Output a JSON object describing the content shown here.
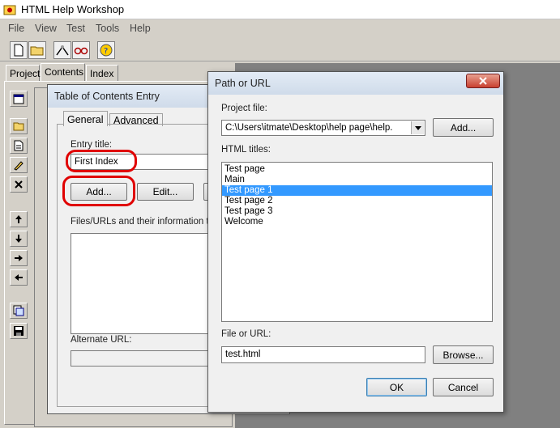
{
  "app": {
    "title": "HTML Help Workshop"
  },
  "menu": [
    "File",
    "View",
    "Test",
    "Tools",
    "Help"
  ],
  "toolbar_icons": [
    "new-file-icon",
    "open-folder-icon",
    "compile-icon",
    "view-icon",
    "help-icon"
  ],
  "left_tabs": [
    "Project",
    "Contents",
    "Index"
  ],
  "toc_dialog": {
    "title": "Table of Contents Entry",
    "tabs": [
      "General",
      "Advanced"
    ],
    "entry_title_label": "Entry title:",
    "entry_title_value": "First Index",
    "add_label": "Add...",
    "edit_label": "Edit...",
    "files_label": "Files/URLs and their information typ",
    "alt_url_label": "Alternate URL:"
  },
  "path_dialog": {
    "title": "Path or URL",
    "project_file_label": "Project file:",
    "project_file_value": "C:\\Users\\itmate\\Desktop\\help page\\help.",
    "add_label": "Add...",
    "html_titles_label": "HTML titles:",
    "html_titles": [
      "Test page",
      "Main",
      "Test page 1",
      "Test page 2",
      "Test page 3",
      "Welcome"
    ],
    "selected_index": 2,
    "file_url_label": "File or URL:",
    "file_url_value": "test.html",
    "browse_label": "Browse...",
    "ok_label": "OK",
    "cancel_label": "Cancel"
  },
  "colors": {
    "selection": "#3399ff",
    "highlight": "#e00000"
  }
}
